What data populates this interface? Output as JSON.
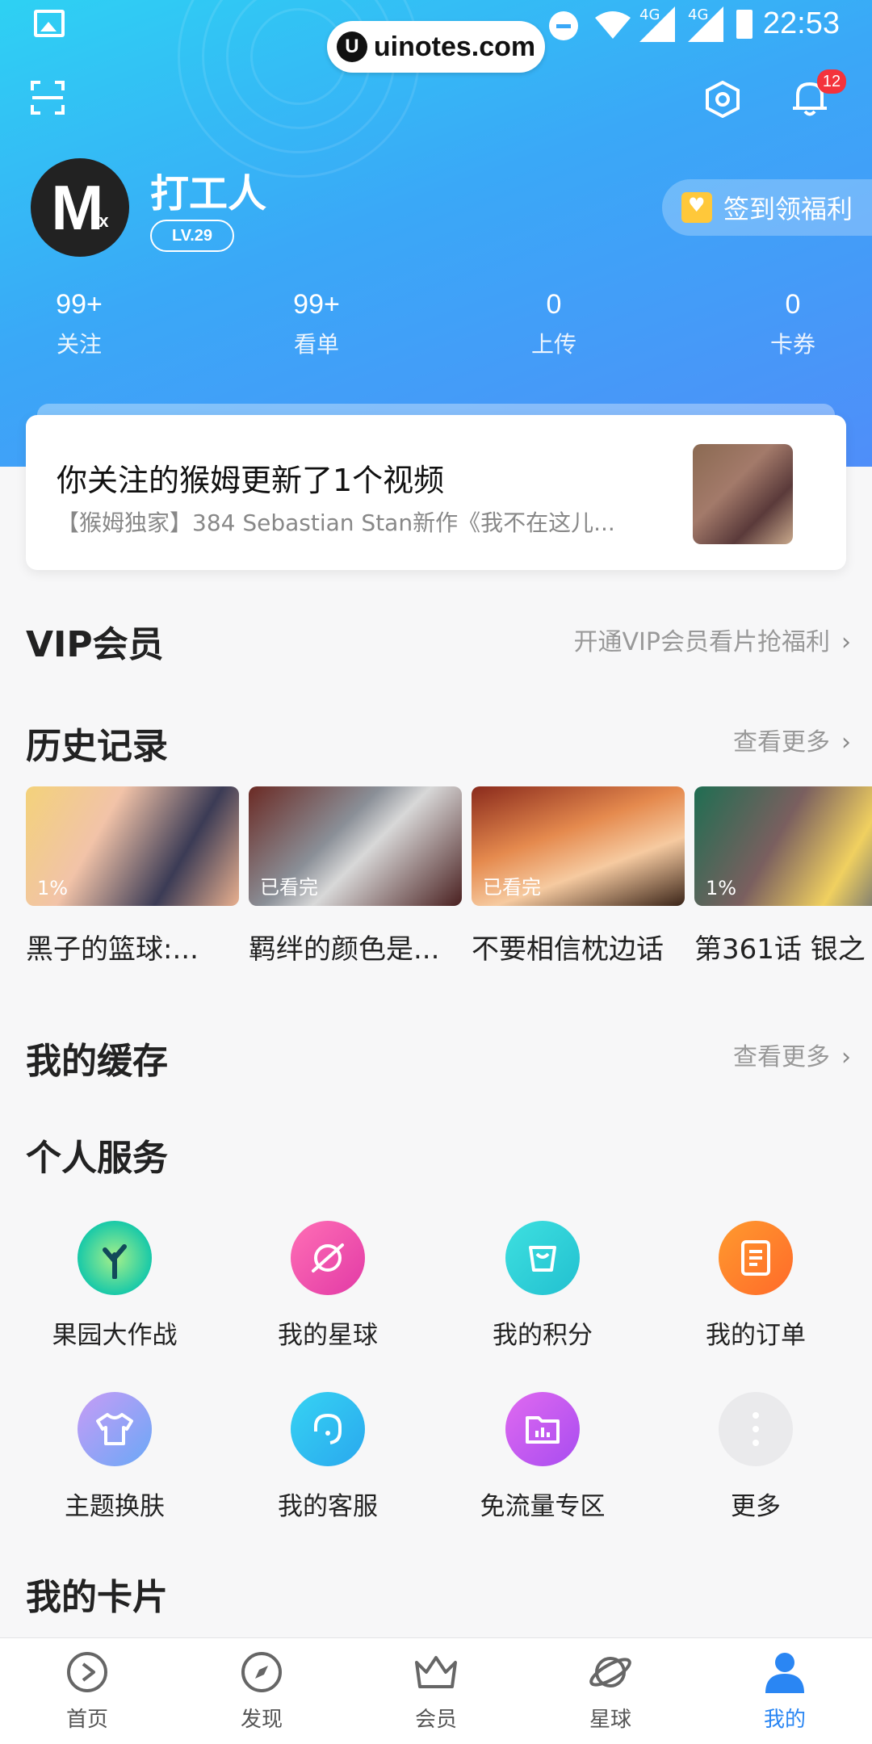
{
  "status_bar": {
    "time": "22:53",
    "network_1": "4G",
    "network_2": "4G"
  },
  "watermark": "uinotes.com",
  "header": {
    "notification_count": "12"
  },
  "profile": {
    "avatar_text": "M",
    "username": "打工人",
    "level": "LV.29",
    "signin_label": "签到领福利"
  },
  "stats": [
    {
      "value": "99+",
      "label": "关注"
    },
    {
      "value": "99+",
      "label": "看单"
    },
    {
      "value": "0",
      "label": "上传"
    },
    {
      "value": "0",
      "label": "卡券"
    }
  ],
  "notification": {
    "title": "你关注的猴姆更新了1个视频",
    "subtitle": "【猴姆独家】384 Sebastian Stan新作《我不在这儿..."
  },
  "vip": {
    "title": "VIP会员",
    "link": "开通VIP会员看片抢福利"
  },
  "history": {
    "title": "历史记录",
    "link": "查看更多",
    "items": [
      {
        "title": "黑子的篮球:...",
        "badge": "1%"
      },
      {
        "title": "羁绊的颜色是...",
        "badge": "已看完"
      },
      {
        "title": "不要相信枕边话",
        "badge": "已看完"
      },
      {
        "title": "第361话 银之",
        "badge": "1%"
      }
    ]
  },
  "cache": {
    "title": "我的缓存",
    "link": "查看更多"
  },
  "services": {
    "title": "个人服务",
    "items": [
      {
        "label": "果园大作战",
        "icon": "tree-icon",
        "color": "#19c9a8"
      },
      {
        "label": "我的星球",
        "icon": "planet-icon",
        "color": "#f14fb0"
      },
      {
        "label": "我的积分",
        "icon": "bag-icon",
        "color": "#2ed1d6"
      },
      {
        "label": "我的订单",
        "icon": "document-icon",
        "color": "#ff8a2e"
      },
      {
        "label": "主题换肤",
        "icon": "tshirt-icon",
        "color": "#8c8cf7"
      },
      {
        "label": "我的客服",
        "icon": "headset-icon",
        "color": "#2bc6ee"
      },
      {
        "label": "免流量专区",
        "icon": "chart-folder-icon",
        "color": "#c45cf0"
      },
      {
        "label": "更多",
        "icon": "more-icon",
        "color": "#eeeeee"
      }
    ]
  },
  "cards": {
    "title": "我的卡片"
  },
  "tabs": [
    {
      "label": "首页",
      "icon": "play-icon"
    },
    {
      "label": "发现",
      "icon": "compass-icon"
    },
    {
      "label": "会员",
      "icon": "crown-icon"
    },
    {
      "label": "星球",
      "icon": "planet-icon"
    },
    {
      "label": "我的",
      "icon": "person-icon",
      "active": true
    }
  ],
  "colors": {
    "accent": "#2a86f3",
    "header_gradient_start": "#2ed1f3",
    "header_gradient_end": "#4f8ef9"
  }
}
